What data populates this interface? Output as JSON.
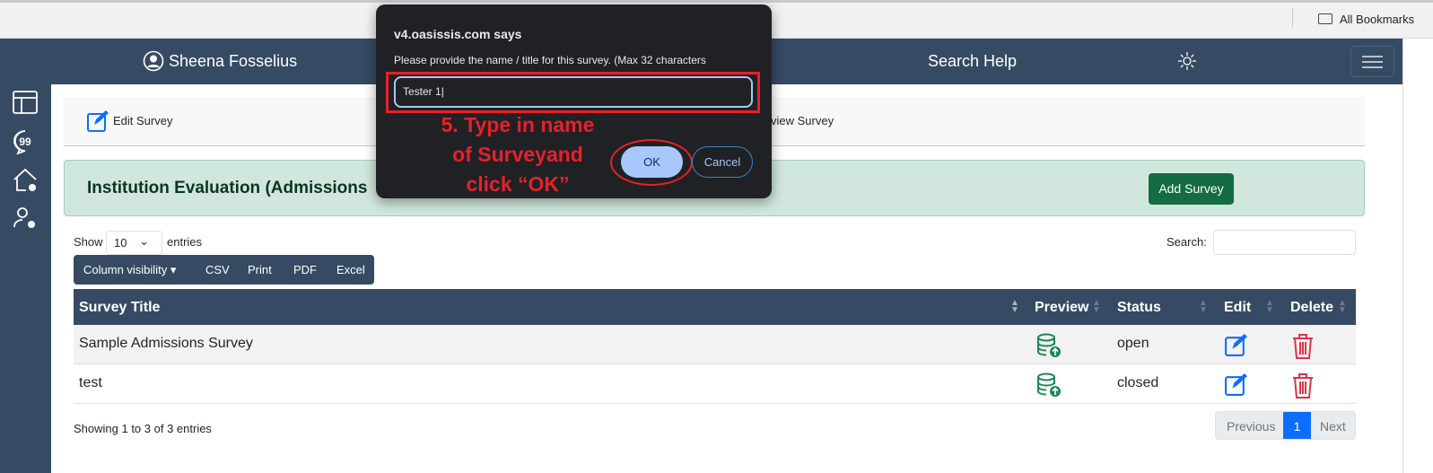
{
  "browser": {
    "bookmarks": "All Bookmarks"
  },
  "navbar": {
    "user": "Sheena Fosselius",
    "search_help": "Search Help",
    "theme_icon": "sun-icon",
    "menu_icon": "hamburger-icon"
  },
  "toolbar": {
    "edit_survey": "Edit Survey",
    "preview_survey": "view Survey"
  },
  "card": {
    "title": "Institution Evaluation (Admissions",
    "add_button": "Add Survey"
  },
  "table_controls": {
    "show": "Show",
    "length": "10",
    "entries": "entries",
    "search_label": "Search:",
    "buttons": [
      "Column visibility",
      "CSV",
      "Print",
      "PDF",
      "Excel"
    ]
  },
  "table": {
    "headers": [
      "Survey Title",
      "Preview",
      "Status",
      "Edit",
      "Delete"
    ],
    "rows": [
      {
        "title": "Sample Admissions Survey",
        "status": "open"
      },
      {
        "title": "test",
        "status": "closed"
      }
    ]
  },
  "footer": {
    "info": "Showing 1 to 3 of 3 entries",
    "previous": "Previous",
    "page": "1",
    "next": "Next"
  },
  "dialog": {
    "origin": "v4.oasissis.com says",
    "message": "Please provide the name / title for this survey. (Max 32 characters",
    "value": "Tester 1",
    "ok": "OK",
    "cancel": "Cancel"
  },
  "annotation": {
    "lines": [
      "5. Type in name",
      "of Surveyand",
      "click “OK”"
    ]
  },
  "colors": {
    "nav": "#364a63",
    "success": "#146c43",
    "primary": "#0d6efd",
    "danger": "#dc3545",
    "annotation": "#e8202a"
  }
}
